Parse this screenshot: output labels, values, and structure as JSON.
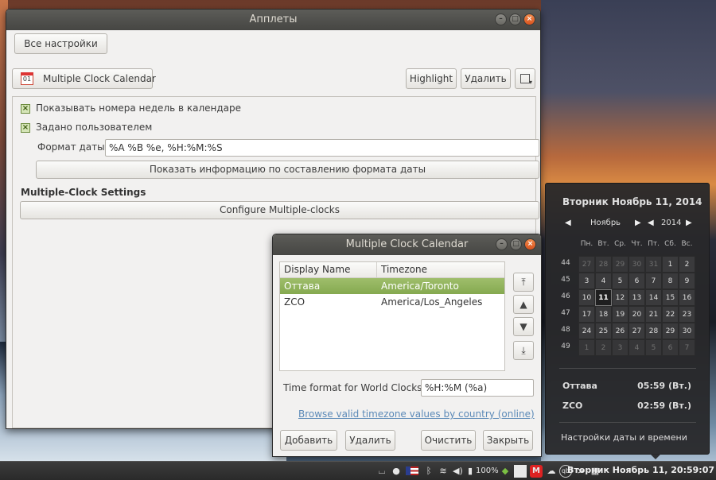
{
  "applets_window": {
    "title": "Апплеты",
    "all_settings": "Все настройки",
    "applet_name": "Multiple Clock Calendar",
    "applet_icon_text": "01",
    "highlight": "Highlight",
    "delete": "Удалить",
    "opt_week_numbers": "Показывать номера недель в календаре",
    "opt_custom": "Задано пользователем",
    "date_format_label": "Формат даты:",
    "date_format_value": "%A %B %e, %H:%M:%S",
    "show_format_info": "Показать информацию по составлению формата даты",
    "section_title": "Multiple-Clock Settings",
    "configure": "Configure Multiple-clocks"
  },
  "dialog": {
    "title": "Multiple Clock Calendar",
    "col_display": "Display Name",
    "col_tz": "Timezone",
    "rows": [
      {
        "name": "Оттава",
        "tz": "America/Toronto"
      },
      {
        "name": "ZCO",
        "tz": "America/Los_Angeles"
      }
    ],
    "time_format_label": "Time format for World Clocks",
    "time_format_value": "%H:%M (%a)",
    "browse_link": "Browse valid timezone values by country (online)",
    "add": "Добавить",
    "remove": "Удалить",
    "clear": "Очистить",
    "close": "Закрыть"
  },
  "calendar": {
    "date_heading": "Вторник Ноябрь 11, 2014",
    "month": "Ноябрь",
    "year": "2014",
    "weekdays": [
      "Пн.",
      "Вт.",
      "Ср.",
      "Чт.",
      "Пт.",
      "Сб.",
      "Вс."
    ],
    "week_numbers": [
      "44",
      "45",
      "46",
      "47",
      "48",
      "49"
    ],
    "days": [
      [
        "27",
        "28",
        "29",
        "30",
        "31",
        "1",
        "2"
      ],
      [
        "3",
        "4",
        "5",
        "6",
        "7",
        "8",
        "9"
      ],
      [
        "10",
        "11",
        "12",
        "13",
        "14",
        "15",
        "16"
      ],
      [
        "17",
        "18",
        "19",
        "20",
        "21",
        "22",
        "23"
      ],
      [
        "24",
        "25",
        "26",
        "27",
        "28",
        "29",
        "30"
      ],
      [
        "1",
        "2",
        "3",
        "4",
        "5",
        "6",
        "7"
      ]
    ],
    "today": "11",
    "clocks": [
      {
        "name": "Оттава",
        "time": "05:59 (Вт.)"
      },
      {
        "name": "ZCO",
        "time": "02:59 (Вт.)"
      }
    ],
    "settings_link": "Настройки даты и времени"
  },
  "panel": {
    "battery": "100%",
    "clock": "Вторник Ноябрь 11, 20:59:07"
  },
  "colors": {
    "accent_selection": "#9fbe6b",
    "link": "#5c8ab8",
    "close_button": "#e46a2f"
  }
}
